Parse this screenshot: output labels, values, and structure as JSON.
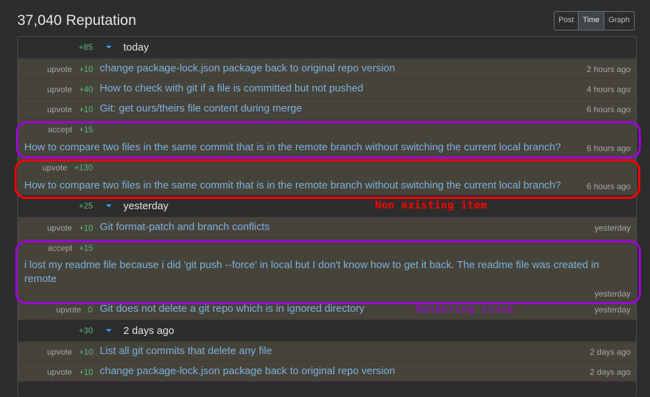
{
  "header": {
    "title": "37,040 Reputation",
    "view_toggle": [
      {
        "label": "Post",
        "active": false
      },
      {
        "label": "Time",
        "active": true
      },
      {
        "label": "Graph",
        "active": false
      }
    ]
  },
  "groups": [
    {
      "label": "today",
      "total": "+85",
      "items": [
        {
          "type": "upvote",
          "amount": "+10",
          "title": "change package-lock.json package back to original repo version",
          "time": "2 hours ago"
        },
        {
          "type": "upvote",
          "amount": "+40",
          "title": "How to check with git if a file is committed but not pushed",
          "time": "4 hours ago"
        },
        {
          "type": "upvote",
          "amount": "+10",
          "title": "Git: get ours/theirs file content during merge",
          "time": "6 hours ago"
        },
        {
          "type": "accept",
          "amount": "+15",
          "title": "How to compare two files in the same commit that is in the remote branch without switching the current local branch?",
          "time": "6 hours ago"
        },
        {
          "type": "upvote",
          "amount": "+130",
          "title": "How to compare two files in the same commit that is in the remote branch without switching the current local branch?",
          "time": "6 hours ago"
        }
      ]
    },
    {
      "label": "yesterday",
      "total": "+25",
      "items": [
        {
          "type": "upvote",
          "amount": "+10",
          "title": "Git format-patch and branch conflicts",
          "time": "yesterday"
        },
        {
          "type": "accept",
          "amount": "+15",
          "title": "i lost my readme file because i did 'git push --force' in local but I don't know how to get it back. The readme file was created in remote",
          "time": "yesterday"
        },
        {
          "type": "upvote",
          "amount": "0",
          "title": "Git does not delete a git repo which is in ignored directory",
          "time": "yesterday"
        }
      ]
    },
    {
      "label": "2 days ago",
      "total": "+30",
      "items": [
        {
          "type": "upvote",
          "amount": "+10",
          "title": "List all git commits that delete any file",
          "time": "2 days ago"
        },
        {
          "type": "upvote",
          "amount": "+10",
          "title": "change package-lock.json package back to original repo version",
          "time": "2 days ago"
        }
      ]
    }
  ],
  "annotations": {
    "non_existing": {
      "text": "Non existing item",
      "color": "#ff0000"
    },
    "rendering": {
      "text": "Rendering issue",
      "color": "#a000e0"
    }
  },
  "colors": {
    "accent_caret": "#3ca4ff",
    "positive": "#5fba7d",
    "link": "#7eb2df",
    "row_bg": "#46433a"
  }
}
